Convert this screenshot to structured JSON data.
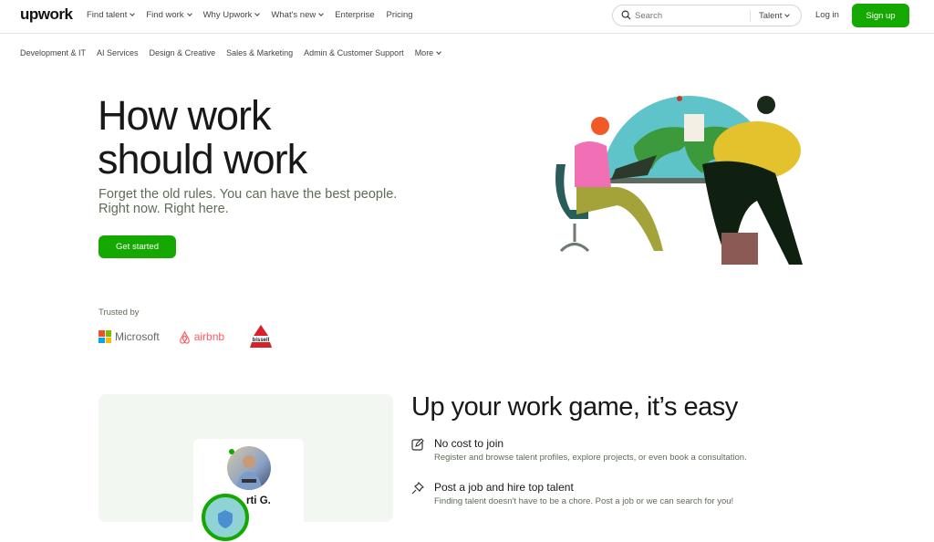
{
  "header": {
    "logo": "upwork",
    "nav": [
      {
        "label": "Find talent",
        "has_dropdown": true
      },
      {
        "label": "Find work",
        "has_dropdown": true
      },
      {
        "label": "Why Upwork",
        "has_dropdown": true
      },
      {
        "label": "What's new",
        "has_dropdown": true
      },
      {
        "label": "Enterprise",
        "has_dropdown": false
      },
      {
        "label": "Pricing",
        "has_dropdown": false
      }
    ],
    "search": {
      "placeholder": "Search",
      "scope": "Talent"
    },
    "login_label": "Log in",
    "signup_label": "Sign up"
  },
  "categories": [
    {
      "label": "Development & IT"
    },
    {
      "label": "AI Services"
    },
    {
      "label": "Design & Creative"
    },
    {
      "label": "Sales & Marketing"
    },
    {
      "label": "Admin & Customer Support"
    },
    {
      "label": "More",
      "has_dropdown": true
    }
  ],
  "hero": {
    "title_line1": "How work",
    "title_line2": "should work",
    "subtitle_line1": "Forget the old rules. You can have the best people.",
    "subtitle_line2": "Right now. Right here.",
    "cta_label": "Get started",
    "illustration": "two-people-working-globe-illustration"
  },
  "trusted": {
    "label": "Trusted by",
    "logos": [
      {
        "name": "Microsoft"
      },
      {
        "name": "airbnb"
      },
      {
        "name": "bissell"
      }
    ]
  },
  "profile_card": {
    "name": "rti G.",
    "online": true
  },
  "features": {
    "title": "Up your work game, it’s easy",
    "items": [
      {
        "icon": "edit-icon",
        "heading": "No cost to join",
        "desc": "Register and browse talent profiles, explore projects, or even book a consultation."
      },
      {
        "icon": "pin-icon",
        "heading": "Post a job and hire top talent",
        "desc": "Finding talent doesn't have to be a chore. Post a job or we can search for you!"
      }
    ]
  },
  "colors": {
    "brand_green": "#14a800",
    "text_muted": "#5e6d55"
  }
}
